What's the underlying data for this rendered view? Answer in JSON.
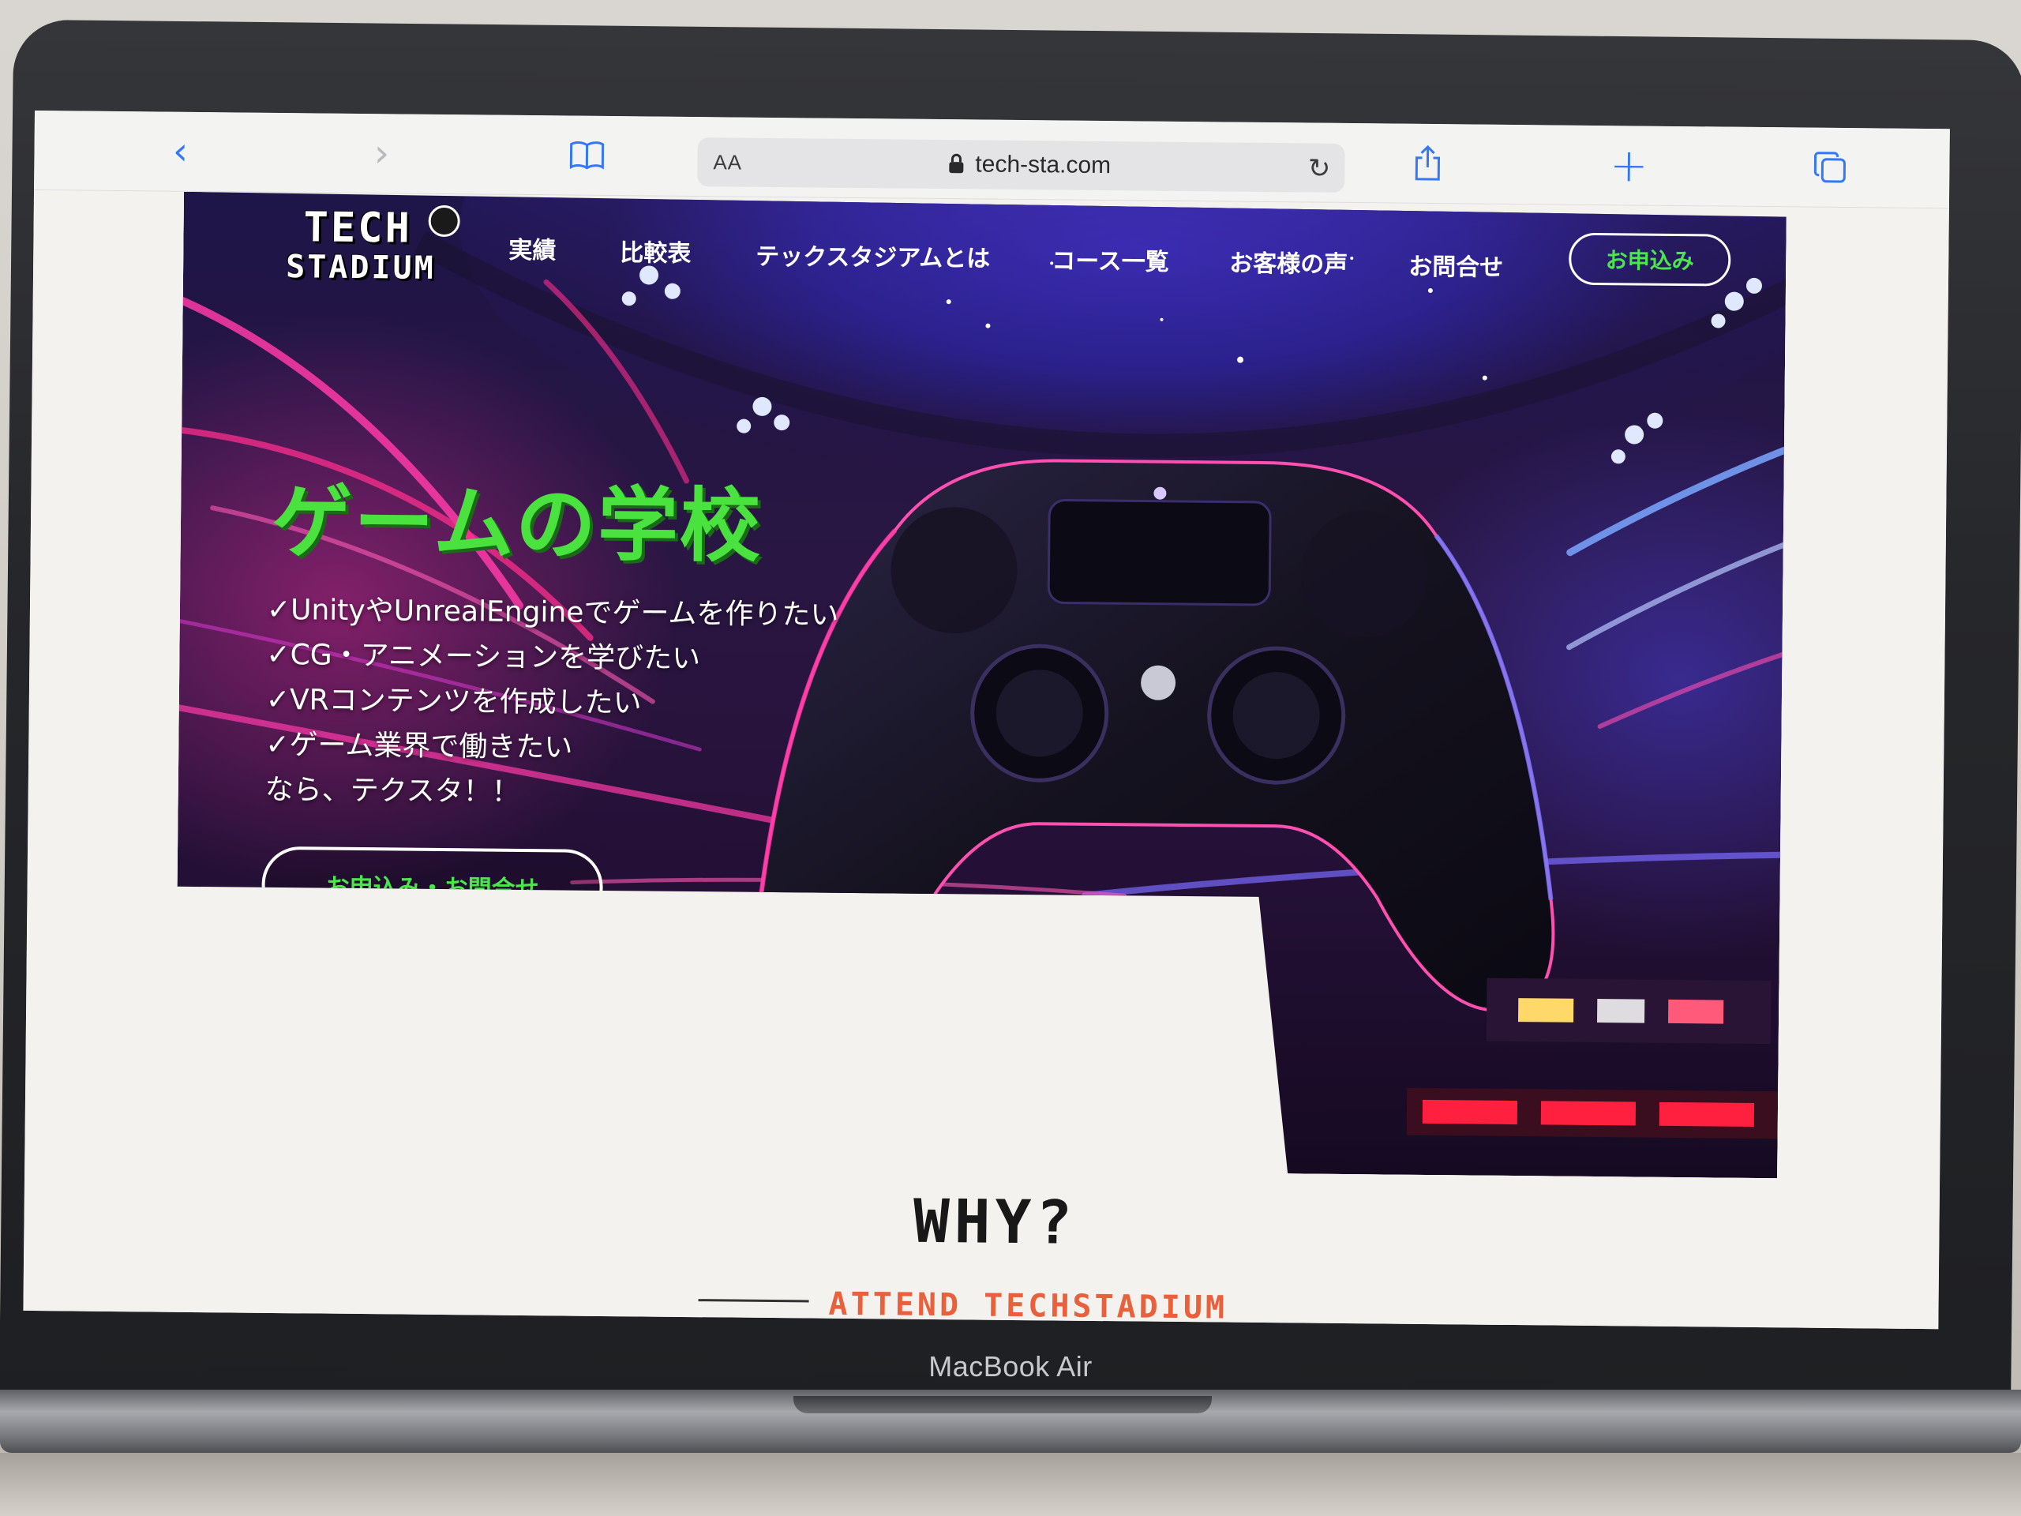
{
  "browser": {
    "text_size_label": "AA",
    "url": "tech-sta.com",
    "accent_color": "#3478f6"
  },
  "device": {
    "label": "MacBook Air"
  },
  "site": {
    "logo": {
      "line1": "TECH",
      "line2": "STADIUM"
    },
    "nav": {
      "items": [
        "実績",
        "比較表",
        "テックスタジアムとは",
        "コース一覧",
        "お客様の声",
        "お問合せ"
      ],
      "apply": "お申込み"
    },
    "hero": {
      "headline": "ゲームの学校",
      "bullets": [
        "✓UnityやUnrealEngineでゲームを作りたい",
        "✓CG・アニメーションを学びたい",
        "✓VRコンテンツを作成したい",
        "✓ゲーム業界で働きたい",
        "なら、テクスタ！！"
      ],
      "cta": "お申込み・お問合せ",
      "headline_color": "#49e23f",
      "cta_text_color": "#4ce64c"
    },
    "why": {
      "title": "WHY?",
      "subtitle": "ATTEND TECHSTADIUM",
      "subtitle_color": "#e8603c"
    }
  }
}
